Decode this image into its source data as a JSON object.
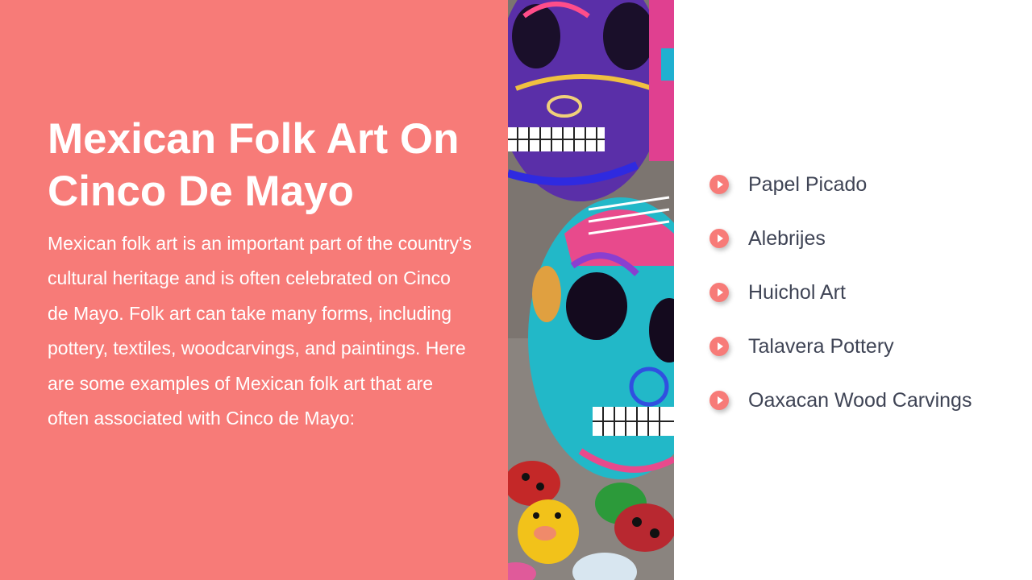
{
  "slide": {
    "title": "Mexican Folk Art On Cinco De Mayo",
    "body": "Mexican folk art is an important part of the country's cultural heritage and is often celebrated on Cinco de Mayo. Folk art can take many forms, including pottery, textiles, woodcarvings, and paintings. Here are some examples of Mexican folk art that are often associated with Cinco de Mayo:",
    "items": [
      {
        "label": "Papel Picado"
      },
      {
        "label": "Alebrijes"
      },
      {
        "label": "Huichol Art"
      },
      {
        "label": "Talavera Pottery"
      },
      {
        "label": "Oaxacan Wood Carvings"
      }
    ]
  },
  "colors": {
    "accent": "#f77b78",
    "text_dark": "#3f4455",
    "background": "#ffffff"
  },
  "icons": {
    "bullet": "play-circle-icon"
  }
}
